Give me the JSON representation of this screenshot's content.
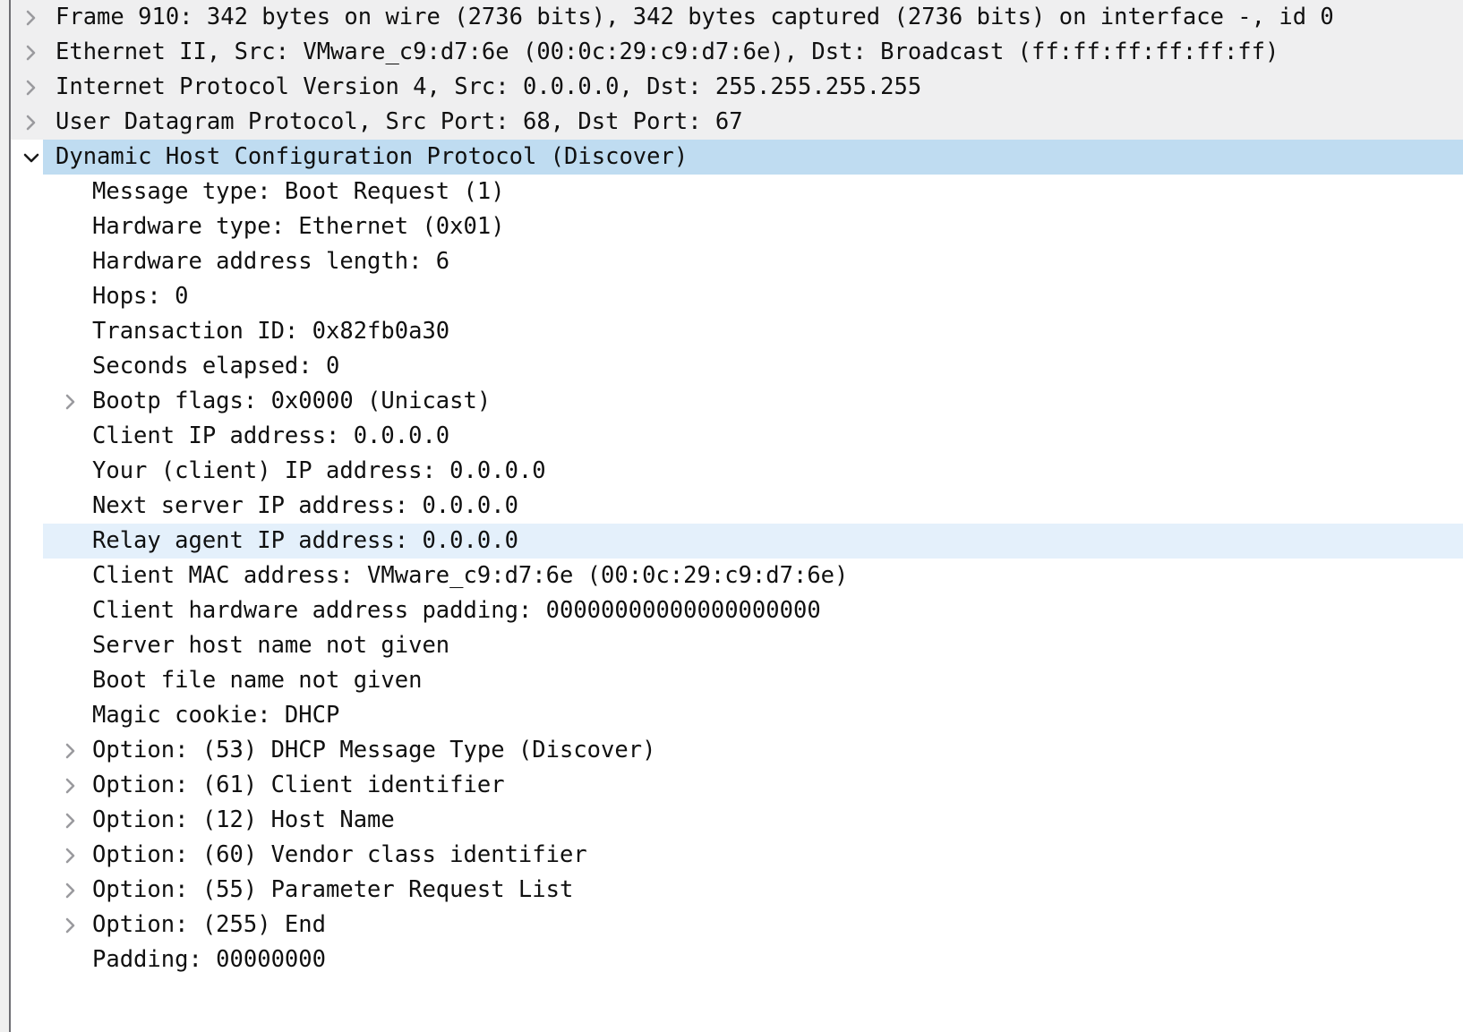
{
  "pane": {
    "name": "packet-details",
    "application": "Wireshark",
    "colors": {
      "row_background_default": "#ffffff",
      "row_background_collapsed": "#efeff0",
      "row_background_selected": "#bfdcf1",
      "row_background_hover": "#e4f0fb",
      "text": "#101010",
      "twisty": "#9a9a9e",
      "twisty_expanded": "#1a1a1a",
      "gutter": "#f0f0f0",
      "guide_line": "#6e6e73"
    },
    "icons": {
      "collapsed": "chevron-right-icon",
      "expanded": "chevron-down-icon"
    }
  },
  "rows": [
    {
      "text": "Frame 910: 342 bytes on wire (2736 bits), 342 bytes captured (2736 bits) on interface -, id 0",
      "level": 0,
      "twisty": "collapsed",
      "state": "collapsed",
      "background": "gray",
      "name": "tree-row-frame"
    },
    {
      "text": "Ethernet II, Src: VMware_c9:d7:6e (00:0c:29:c9:d7:6e), Dst: Broadcast (ff:ff:ff:ff:ff:ff)",
      "level": 0,
      "twisty": "collapsed",
      "state": "collapsed",
      "background": "gray",
      "name": "tree-row-ethernet"
    },
    {
      "text": "Internet Protocol Version 4, Src: 0.0.0.0, Dst: 255.255.255.255",
      "level": 0,
      "twisty": "collapsed",
      "state": "collapsed",
      "background": "gray",
      "name": "tree-row-ipv4"
    },
    {
      "text": "User Datagram Protocol, Src Port: 68, Dst Port: 67",
      "level": 0,
      "twisty": "collapsed",
      "state": "collapsed",
      "background": "gray",
      "name": "tree-row-udp"
    },
    {
      "text": "Dynamic Host Configuration Protocol (Discover)",
      "level": 0,
      "twisty": "expanded",
      "state": "selected",
      "background": "select",
      "name": "tree-row-dhcp"
    },
    {
      "text": "Message type: Boot Request (1)",
      "level": 1,
      "twisty": "none",
      "state": "leaf",
      "background": "none",
      "name": "tree-row-message-type"
    },
    {
      "text": "Hardware type: Ethernet (0x01)",
      "level": 1,
      "twisty": "none",
      "state": "leaf",
      "background": "none",
      "name": "tree-row-hardware-type"
    },
    {
      "text": "Hardware address length: 6",
      "level": 1,
      "twisty": "none",
      "state": "leaf",
      "background": "none",
      "name": "tree-row-hardware-address-length"
    },
    {
      "text": "Hops: 0",
      "level": 1,
      "twisty": "none",
      "state": "leaf",
      "background": "none",
      "name": "tree-row-hops"
    },
    {
      "text": "Transaction ID: 0x82fb0a30",
      "level": 1,
      "twisty": "none",
      "state": "leaf",
      "background": "none",
      "name": "tree-row-transaction-id"
    },
    {
      "text": "Seconds elapsed: 0",
      "level": 1,
      "twisty": "none",
      "state": "leaf",
      "background": "none",
      "name": "tree-row-seconds-elapsed"
    },
    {
      "text": "Bootp flags: 0x0000 (Unicast)",
      "level": 1,
      "twisty": "collapsed",
      "state": "collapsed",
      "background": "none",
      "name": "tree-row-bootp-flags"
    },
    {
      "text": "Client IP address: 0.0.0.0",
      "level": 1,
      "twisty": "none",
      "state": "leaf",
      "background": "none",
      "name": "tree-row-client-ip-address"
    },
    {
      "text": "Your (client) IP address: 0.0.0.0",
      "level": 1,
      "twisty": "none",
      "state": "leaf",
      "background": "none",
      "name": "tree-row-your-client-ip-address"
    },
    {
      "text": "Next server IP address: 0.0.0.0",
      "level": 1,
      "twisty": "none",
      "state": "leaf",
      "background": "none",
      "name": "tree-row-next-server-ip-address"
    },
    {
      "text": "Relay agent IP address: 0.0.0.0",
      "level": 1,
      "twisty": "none",
      "state": "hover",
      "background": "hover",
      "name": "tree-row-relay-agent-ip-address"
    },
    {
      "text": "Client MAC address: VMware_c9:d7:6e (00:0c:29:c9:d7:6e)",
      "level": 1,
      "twisty": "none",
      "state": "leaf",
      "background": "none",
      "name": "tree-row-client-mac-address"
    },
    {
      "text": "Client hardware address padding: 00000000000000000000",
      "level": 1,
      "twisty": "none",
      "state": "leaf",
      "background": "none",
      "name": "tree-row-client-hardware-address-padding"
    },
    {
      "text": "Server host name not given",
      "level": 1,
      "twisty": "none",
      "state": "leaf",
      "background": "none",
      "name": "tree-row-server-host-name"
    },
    {
      "text": "Boot file name not given",
      "level": 1,
      "twisty": "none",
      "state": "leaf",
      "background": "none",
      "name": "tree-row-boot-file-name"
    },
    {
      "text": "Magic cookie: DHCP",
      "level": 1,
      "twisty": "none",
      "state": "leaf",
      "background": "none",
      "name": "tree-row-magic-cookie"
    },
    {
      "text": "Option: (53) DHCP Message Type (Discover)",
      "level": 1,
      "twisty": "collapsed",
      "state": "collapsed",
      "background": "none",
      "name": "tree-row-option-53"
    },
    {
      "text": "Option: (61) Client identifier",
      "level": 1,
      "twisty": "collapsed",
      "state": "collapsed",
      "background": "none",
      "name": "tree-row-option-61"
    },
    {
      "text": "Option: (12) Host Name",
      "level": 1,
      "twisty": "collapsed",
      "state": "collapsed",
      "background": "none",
      "name": "tree-row-option-12"
    },
    {
      "text": "Option: (60) Vendor class identifier",
      "level": 1,
      "twisty": "collapsed",
      "state": "collapsed",
      "background": "none",
      "name": "tree-row-option-60"
    },
    {
      "text": "Option: (55) Parameter Request List",
      "level": 1,
      "twisty": "collapsed",
      "state": "collapsed",
      "background": "none",
      "name": "tree-row-option-55"
    },
    {
      "text": "Option: (255) End",
      "level": 1,
      "twisty": "collapsed",
      "state": "collapsed",
      "background": "none",
      "name": "tree-row-option-255"
    },
    {
      "text": "Padding: 00000000",
      "level": 1,
      "twisty": "none",
      "state": "leaf",
      "background": "none",
      "name": "tree-row-padding"
    }
  ]
}
